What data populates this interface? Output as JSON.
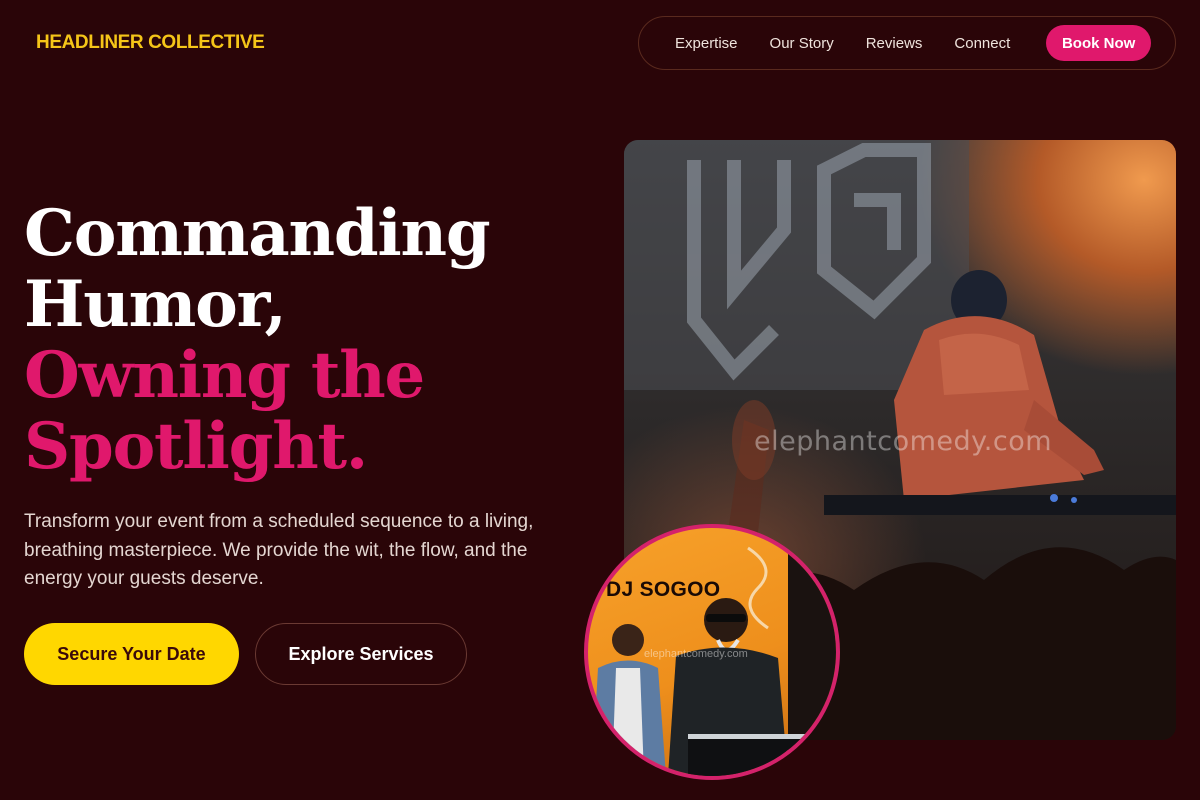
{
  "brand": {
    "name": "HEADLINER COLLECTIVE"
  },
  "nav": {
    "items": [
      "Expertise",
      "Our Story",
      "Reviews",
      "Connect"
    ],
    "cta": "Book Now"
  },
  "hero": {
    "headline_line1": "Commanding",
    "headline_line2": "Humor,",
    "headline_line3": "Owning the",
    "headline_line4": "Spotlight.",
    "description": "Transform your event from a scheduled sequence to a living, breathing masterpiece. We provide the wit, the flow, and the energy your guests deserve.",
    "primary_button": "Secure Your Date",
    "secondary_button": "Explore Services"
  },
  "media": {
    "main_watermark": "elephantcomedy.com",
    "inset_sign": "DJ SOGOO",
    "inset_watermark": "elephantcomedy.com"
  },
  "colors": {
    "background": "#2a0508",
    "brand_yellow": "#f5c518",
    "accent_pink": "#e0186c",
    "button_yellow": "#ffd700"
  }
}
